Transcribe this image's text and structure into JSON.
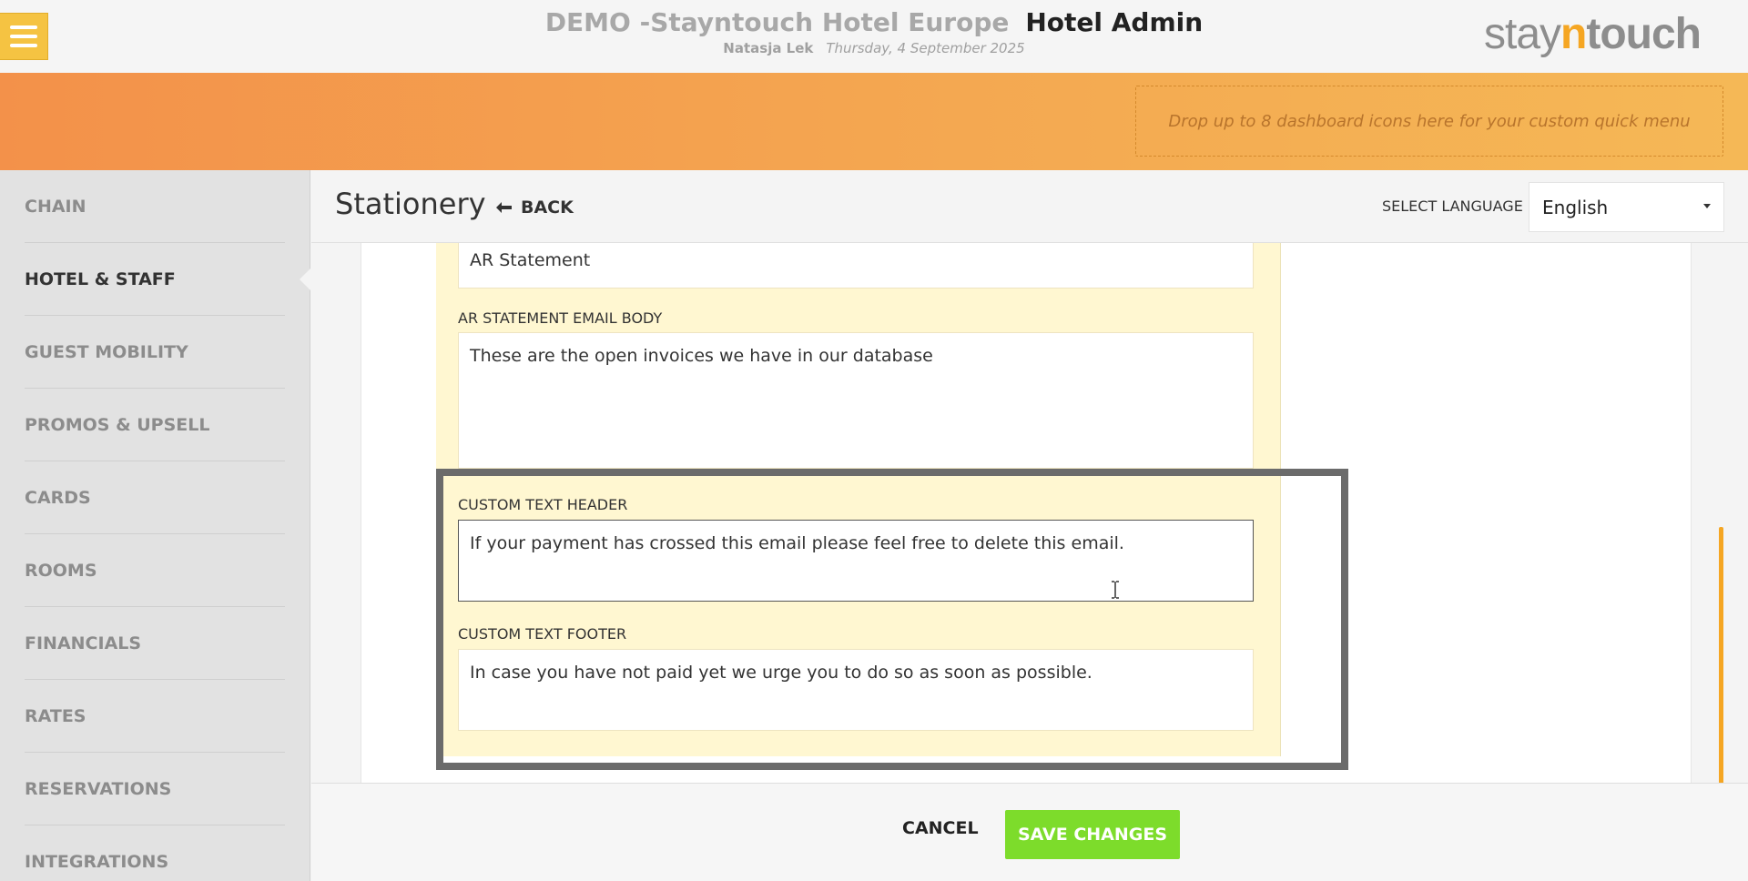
{
  "header": {
    "hotel_name": "DEMO -Stayntouch Hotel Europe",
    "app_name": "Hotel Admin",
    "user_name": "Natasja Lek",
    "date": "Thursday, 4 September 2025",
    "logo": {
      "part1": "stay",
      "part2": "n",
      "part3": "touch"
    },
    "menu_icon": "hamburger-icon"
  },
  "quick_menu": {
    "placeholder": "Drop up to 8 dashboard icons here for your custom quick menu"
  },
  "sidebar": {
    "items": [
      {
        "label": "CHAIN",
        "active": false
      },
      {
        "label": "HOTEL & STAFF",
        "active": true
      },
      {
        "label": "GUEST MOBILITY",
        "active": false
      },
      {
        "label": "PROMOS & UPSELL",
        "active": false
      },
      {
        "label": "CARDS",
        "active": false
      },
      {
        "label": "ROOMS",
        "active": false
      },
      {
        "label": "FINANCIALS",
        "active": false
      },
      {
        "label": "RATES",
        "active": false
      },
      {
        "label": "RESERVATIONS",
        "active": false
      },
      {
        "label": "INTEGRATIONS",
        "active": false
      }
    ]
  },
  "page": {
    "title": "Stationery",
    "back_label": "BACK",
    "back_icon": "arrow-left-icon",
    "language_label": "SELECT LANGUAGE",
    "language_value": "English"
  },
  "form": {
    "ar_statement_subject_value": "AR Statement",
    "email_body_label": "AR STATEMENT EMAIL BODY",
    "email_body_value": "These are the open invoices we have in our database",
    "custom_header_label": "CUSTOM TEXT HEADER",
    "custom_header_value": "If your payment has crossed this email please feel free to delete this email.",
    "custom_footer_label": "CUSTOM TEXT FOOTER",
    "custom_footer_value": "In case you have not paid yet we urge you to do so as soon as possible."
  },
  "footer": {
    "cancel_label": "CANCEL",
    "save_label": "SAVE CHANGES"
  },
  "colors": {
    "accent_orange": "#f5a623",
    "menu_button": "#f5c342",
    "save_green": "#7ddc2b",
    "field_background": "#fff7d1"
  }
}
